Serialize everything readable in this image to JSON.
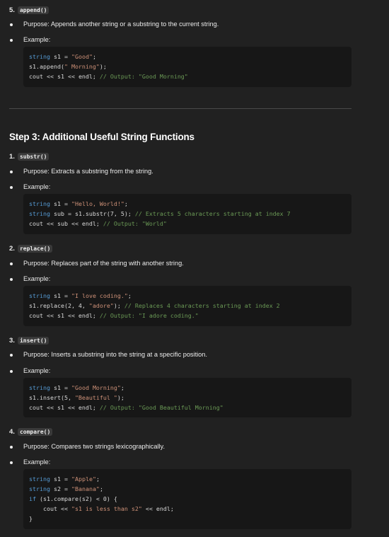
{
  "sections": [
    {
      "number": "5.",
      "func": "append()",
      "purpose": "Purpose: Appends another string or a substring to the current string.",
      "example_label": "Example:",
      "code": [
        [
          [
            "string",
            "k"
          ],
          [
            " s1 = ",
            ""
          ],
          [
            "\"Good\"",
            "s"
          ],
          [
            ";",
            ""
          ]
        ],
        [
          [
            "s1.append(",
            ""
          ],
          [
            "\" Morning\"",
            "s"
          ],
          [
            ");",
            ""
          ]
        ],
        [
          [
            "cout",
            ""
          ],
          [
            " << s1 << ",
            ""
          ],
          [
            "endl",
            ""
          ],
          [
            "; ",
            ""
          ],
          [
            "// Output: \"Good Morning\"",
            "c"
          ]
        ]
      ]
    },
    {
      "number": "1.",
      "func": "substr()",
      "purpose": "Purpose: Extracts a substring from the string.",
      "example_label": "Example:",
      "code": [
        [
          [
            "string",
            "k"
          ],
          [
            " s1 = ",
            ""
          ],
          [
            "\"Hello, World!\"",
            "s"
          ],
          [
            ";",
            ""
          ]
        ],
        [
          [
            "string",
            "k"
          ],
          [
            " sub = s1.substr(7, 5); ",
            ""
          ],
          [
            "// Extracts 5 characters starting at index 7",
            "c"
          ]
        ],
        [
          [
            "cout",
            ""
          ],
          [
            " << sub << endl; ",
            ""
          ],
          [
            "// Output: \"World\"",
            "c"
          ]
        ]
      ]
    },
    {
      "number": "2.",
      "func": "replace()",
      "purpose": "Purpose: Replaces part of the string with another string.",
      "example_label": "Example:",
      "code": [
        [
          [
            "string",
            "k"
          ],
          [
            " s1 = ",
            ""
          ],
          [
            "\"I love coding.\"",
            "s"
          ],
          [
            ";",
            ""
          ]
        ],
        [
          [
            "s1.replace(2, 4, ",
            ""
          ],
          [
            "\"adore\"",
            "s"
          ],
          [
            "); ",
            ""
          ],
          [
            "// Replaces 4 characters starting at index 2",
            "c"
          ]
        ],
        [
          [
            "cout",
            ""
          ],
          [
            " << s1 << endl; ",
            ""
          ],
          [
            "// Output: \"I adore coding.\"",
            "c"
          ]
        ]
      ]
    },
    {
      "number": "3.",
      "func": "insert()",
      "purpose": "Purpose: Inserts a substring into the string at a specific position.",
      "example_label": "Example:",
      "code": [
        [
          [
            "string",
            "k"
          ],
          [
            " s1 = ",
            ""
          ],
          [
            "\"Good Morning\"",
            "s"
          ],
          [
            ";",
            ""
          ]
        ],
        [
          [
            "s1.insert(5, ",
            ""
          ],
          [
            "\"Beautiful \"",
            "s"
          ],
          [
            ");",
            ""
          ]
        ],
        [
          [
            "cout",
            ""
          ],
          [
            " << s1 << endl; ",
            ""
          ],
          [
            "// Output: \"Good Beautiful Morning\"",
            "c"
          ]
        ]
      ]
    },
    {
      "number": "4.",
      "func": "compare()",
      "purpose": "Purpose: Compares two strings lexicographically.",
      "example_label": "Example:",
      "code": [
        [
          [
            "string",
            "k"
          ],
          [
            " s1 = ",
            ""
          ],
          [
            "\"Apple\"",
            "s"
          ],
          [
            ";",
            ""
          ]
        ],
        [
          [
            "string",
            "k"
          ],
          [
            " s2 = ",
            ""
          ],
          [
            "\"Banana\"",
            "s"
          ],
          [
            ";",
            ""
          ]
        ],
        [
          [
            "if",
            "k"
          ],
          [
            " (s1.compare(s2) < 0) {",
            ""
          ]
        ],
        [
          [
            "    cout << ",
            ""
          ],
          [
            "\"s1 is less than s2\"",
            "s"
          ],
          [
            " << endl;",
            ""
          ]
        ],
        [
          [
            "}",
            ""
          ]
        ]
      ]
    }
  ],
  "heading": "Step 3: Additional Useful String Functions"
}
